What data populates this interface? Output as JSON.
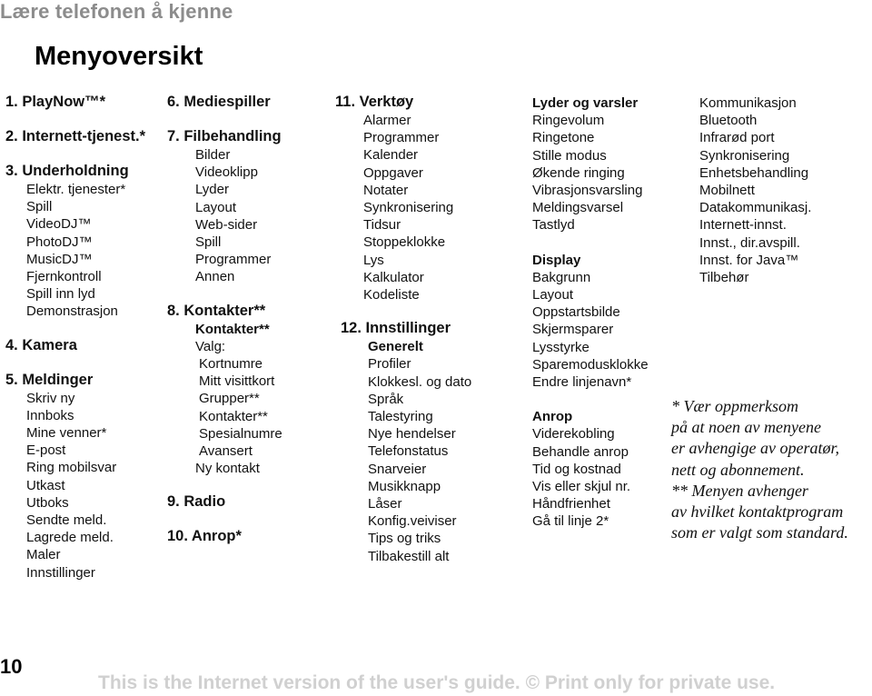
{
  "header": {
    "chapter": "Lære telefonen å kjenne",
    "title": "Menyoversikt"
  },
  "col1": {
    "m1": "1. PlayNow™*",
    "m2": "2. Internett-tjenest.*",
    "m3": "3. Underholdning",
    "m3_items": [
      "Elektr. tjenester*",
      "Spill",
      "VideoDJ™",
      "PhotoDJ™",
      "MusicDJ™",
      "Fjernkontroll",
      "Spill inn lyd",
      "Demonstrasjon"
    ],
    "m4": "4. Kamera",
    "m5": "5. Meldinger",
    "m5_items": [
      "Skriv ny",
      "Innboks",
      "Mine venner*",
      "E-post",
      "Ring mobilsvar",
      "Utkast",
      "Utboks",
      "Sendte meld.",
      "Lagrede meld.",
      "Maler",
      "Innstillinger"
    ]
  },
  "col2": {
    "m6": "6. Mediespiller",
    "m7": "7. Filbehandling",
    "m7_items": [
      "Bilder",
      "Videoklipp",
      "Lyder",
      "Layout",
      "Web-sider",
      "Spill",
      "Programmer",
      "Annen"
    ],
    "m8": "8. Kontakter**",
    "m8_sub": "Kontakter**",
    "m8_valg": "Valg:",
    "m8_valg_items": [
      "Kortnumre",
      "Mitt visittkort",
      "Grupper**",
      "Kontakter**",
      "Spesialnumre",
      "Avansert"
    ],
    "m8_new": "Ny kontakt",
    "m9": "9. Radio",
    "m10": "10. Anrop*"
  },
  "col3": {
    "m11": "11. Verktøy",
    "m11_items": [
      "Alarmer",
      "Programmer",
      "Kalender",
      "Oppgaver",
      "Notater",
      "Synkronisering",
      "Tidsur",
      "Stoppeklokke",
      "Lys",
      "Kalkulator",
      "Kodeliste"
    ],
    "m12": "12. Innstillinger",
    "m12_sub": "Generelt",
    "m12_items": [
      "Profiler",
      "Klokkesl. og dato",
      "Språk",
      "Talestyring",
      "Nye hendelser",
      "Telefonstatus",
      "Snarveier",
      "Musikknapp",
      "Låser",
      "Konfig.veiviser",
      "Tips og triks",
      "Tilbakestill alt"
    ]
  },
  "col4": {
    "sounds_head": "Lyder og varsler",
    "sounds_items": [
      "Ringevolum",
      "Ringetone",
      "Stille modus",
      "Økende ringing",
      "Vibrasjonsvarsling",
      "Meldingsvarsel",
      "Tastlyd"
    ],
    "display_head": "Display",
    "display_items": [
      "Bakgrunn",
      "Layout",
      "Oppstartsbilde",
      "Skjermsparer",
      "Lysstyrke",
      "Sparemodusklokke",
      "Endre linjenavn*"
    ],
    "calls_head": "Anrop",
    "calls_items": [
      "Viderekobling",
      "Behandle anrop",
      "Tid og kostnad",
      "Vis eller skjul nr.",
      "Håndfrienhet",
      "Gå til linje 2*"
    ]
  },
  "col5": {
    "comm_head": "Kommunikasjon",
    "comm_items": [
      "Bluetooth",
      "Infrarød port",
      "Synkronisering",
      "Enhetsbehandling",
      "Mobilnett",
      "Datakommunikasj.",
      "Internett-innst.",
      "Innst., dir.avspill.",
      "Innst. for Java™",
      "Tilbehør"
    ]
  },
  "notes": [
    "* Vær oppmerksom",
    "på at noen av menyene",
    "er avhengige av operatør,",
    "nett og abonnement.",
    "** Menyen avhenger",
    "av hvilket kontaktprogram",
    "som er valgt som standard."
  ],
  "footer": {
    "page_number": "10",
    "notice": "This is the Internet version of the user's guide. © Print only for private use."
  }
}
